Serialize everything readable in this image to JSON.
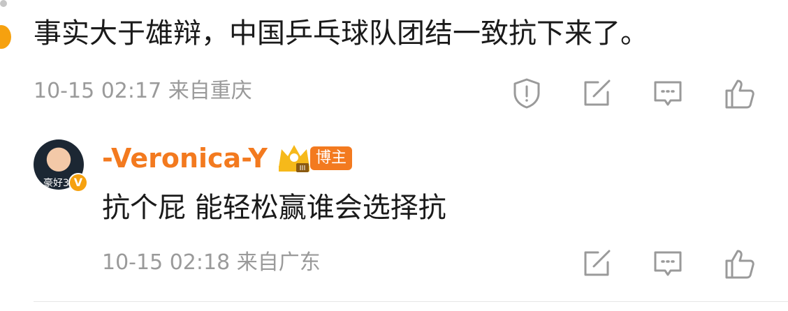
{
  "comment_1": {
    "text": "事实大于雄辩，中国乒乓球队团结一致抗下来了。",
    "meta": "10-15 02:17 来自重庆"
  },
  "reply_1": {
    "username": "-Veronica-Y",
    "role_badge": "博主",
    "crown_level": "III",
    "avatar_caption": "豪好3",
    "verify_mark": "V",
    "text": "抗个屁 能轻松赢谁会选择抗",
    "meta": "10-15 02:18 来自广东"
  },
  "icons": {
    "report": "report-icon",
    "share": "share-icon",
    "comment": "comment-icon",
    "like": "like-icon",
    "crown": "crown-icon"
  },
  "colors": {
    "accent": "#f37a1f",
    "text": "#1a1a1a",
    "meta": "#9a9a9a",
    "icon": "#9a9a9a"
  }
}
